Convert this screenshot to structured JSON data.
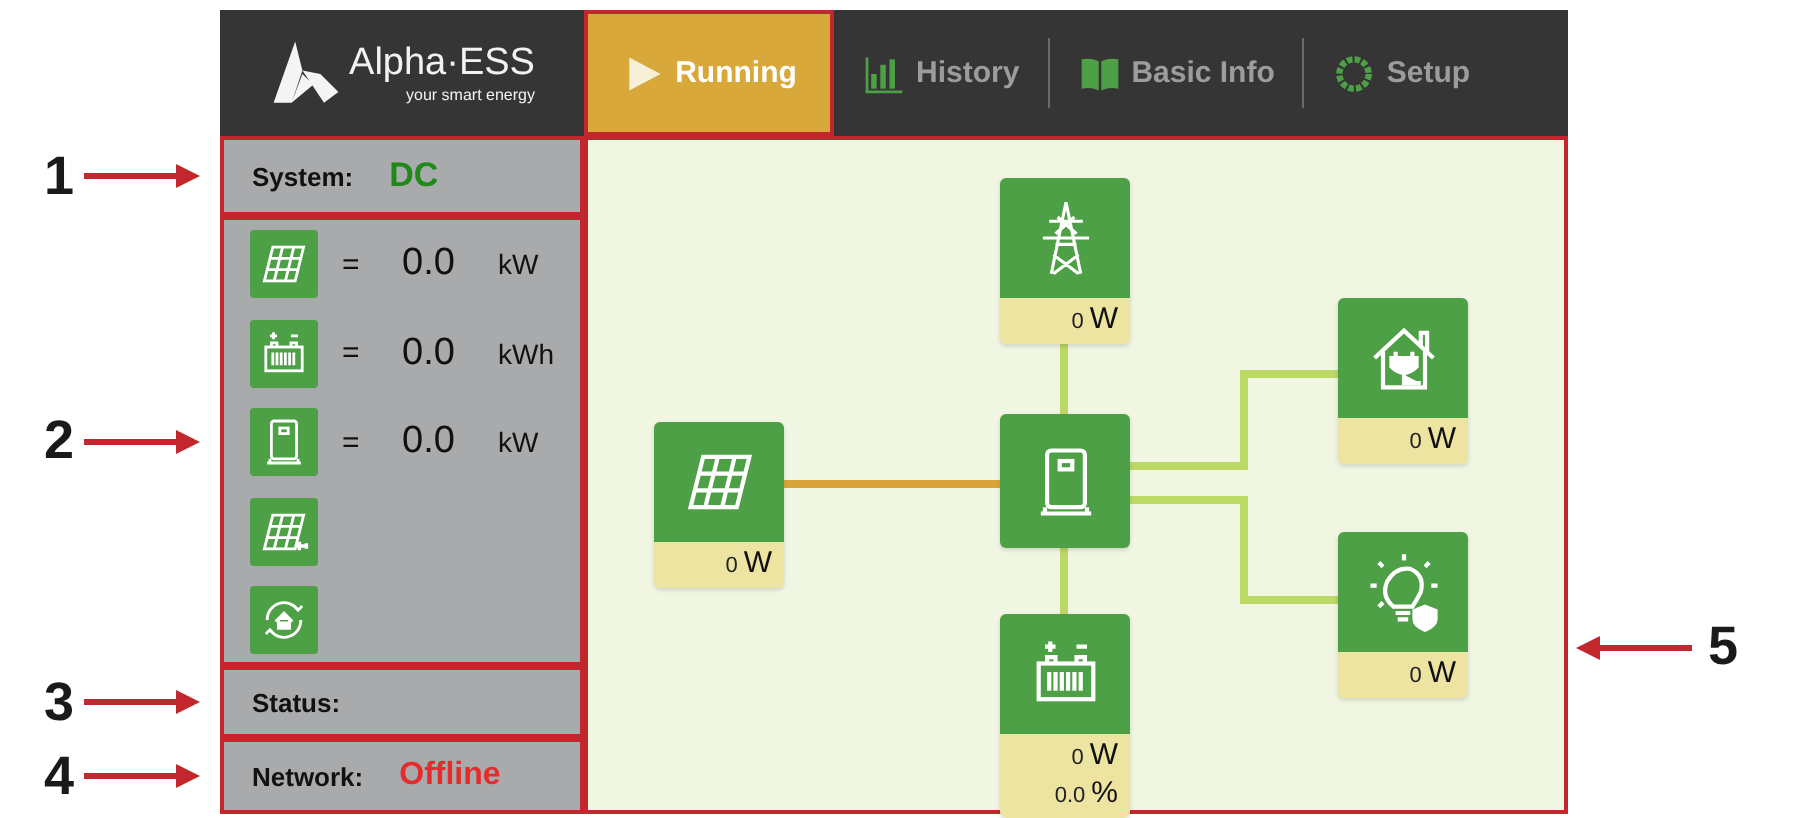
{
  "header": {
    "logo": {
      "name": "Alpha·ESS",
      "tagline": "your smart energy"
    },
    "tabs": [
      {
        "label": "Running",
        "kind": "play",
        "selected": true
      },
      {
        "label": "History",
        "kind": "chart",
        "selected": false
      },
      {
        "label": "Basic Info",
        "kind": "book",
        "selected": false
      },
      {
        "label": "Setup",
        "kind": "gear",
        "selected": false
      }
    ]
  },
  "sidebar": {
    "system": {
      "label": "System:",
      "value": "DC"
    },
    "metrics": [
      {
        "kind": "solar",
        "sign": "=",
        "value": "0.0",
        "unit": "kW"
      },
      {
        "kind": "battery",
        "sign": "=",
        "value": "0.0",
        "unit": "kWh"
      },
      {
        "kind": "inverter",
        "sign": "=",
        "value": "0.0",
        "unit": "kW"
      },
      {
        "kind": "solar-plug"
      },
      {
        "kind": "home-cycle"
      }
    ],
    "status": {
      "label": "Status:"
    },
    "network": {
      "label": "Network:",
      "value": "Offline",
      "online": false
    }
  },
  "diagram": {
    "nodes": [
      {
        "kind": "grid",
        "readings": [
          {
            "value": "0",
            "unit": "W"
          }
        ]
      },
      {
        "kind": "solar",
        "readings": [
          {
            "value": "0",
            "unit": "W"
          }
        ]
      },
      {
        "kind": "inverter"
      },
      {
        "kind": "battery",
        "readings": [
          {
            "value": "0",
            "unit": "W"
          },
          {
            "value": "0.0",
            "unit": "%"
          }
        ]
      },
      {
        "kind": "house",
        "readings": [
          {
            "value": "0",
            "unit": "W"
          }
        ]
      },
      {
        "kind": "bulb",
        "readings": [
          {
            "value": "0",
            "unit": "W"
          }
        ]
      }
    ],
    "links": [
      {
        "kind": "solar",
        "color": "#d9a53a"
      },
      {
        "kind": "grid",
        "color": "#bcd865"
      },
      {
        "kind": "battery",
        "color": "#bcd865"
      },
      {
        "kind": "house",
        "color": "#bcd865"
      },
      {
        "kind": "bulb",
        "color": "#bcd865"
      }
    ]
  },
  "callouts": [
    {
      "label": "1"
    },
    {
      "label": "2"
    },
    {
      "label": "3"
    },
    {
      "label": "4"
    },
    {
      "label": "5"
    }
  ]
}
